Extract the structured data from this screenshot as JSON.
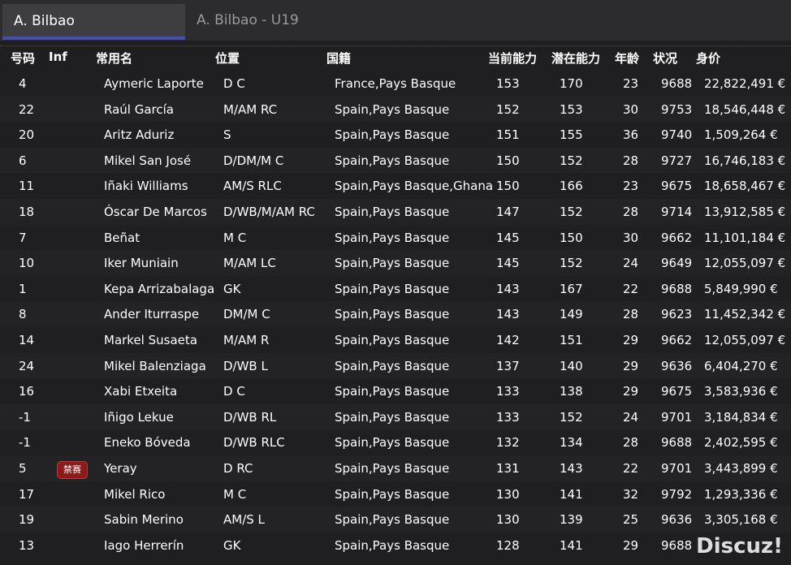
{
  "tabs": [
    {
      "label": "A. Bilbao"
    },
    {
      "label": "A. Bilbao - U19"
    }
  ],
  "headers": {
    "num": "号码",
    "inf": "Inf",
    "name": "常用名",
    "pos": "位置",
    "nat": "国籍",
    "ca": "当前能力",
    "pa": "潜在能力",
    "age": "年龄",
    "cond": "状况",
    "val": "身价"
  },
  "rows": [
    {
      "num": "4",
      "inf": "",
      "name": "Aymeric Laporte",
      "pos": "D C",
      "nat": "France,Pays Basque",
      "ca": "153",
      "pa": "170",
      "age": "23",
      "cond": "9688",
      "val": "22,822,491 €"
    },
    {
      "num": "22",
      "inf": "",
      "name": "Raúl García",
      "pos": "M/AM RC",
      "nat": "Spain,Pays Basque",
      "ca": "152",
      "pa": "153",
      "age": "30",
      "cond": "9753",
      "val": "18,546,448 €"
    },
    {
      "num": "20",
      "inf": "",
      "name": "Aritz Aduriz",
      "pos": "S",
      "nat": "Spain,Pays Basque",
      "ca": "151",
      "pa": "155",
      "age": "36",
      "cond": "9740",
      "val": "1,509,264 €"
    },
    {
      "num": "6",
      "inf": "",
      "name": "Mikel San José",
      "pos": "D/DM/M C",
      "nat": "Spain,Pays Basque",
      "ca": "150",
      "pa": "152",
      "age": "28",
      "cond": "9727",
      "val": "16,746,183 €"
    },
    {
      "num": "11",
      "inf": "",
      "name": "Iñaki Williams",
      "pos": "AM/S RLC",
      "nat": "Spain,Pays Basque,Ghana",
      "ca": "150",
      "pa": "166",
      "age": "23",
      "cond": "9675",
      "val": "18,658,467 €"
    },
    {
      "num": "18",
      "inf": "",
      "name": "Óscar De Marcos",
      "pos": "D/WB/M/AM RC",
      "nat": "Spain,Pays Basque",
      "ca": "147",
      "pa": "152",
      "age": "28",
      "cond": "9714",
      "val": "13,912,585 €"
    },
    {
      "num": "7",
      "inf": "",
      "name": "Beñat",
      "pos": "M C",
      "nat": "Spain,Pays Basque",
      "ca": "145",
      "pa": "150",
      "age": "30",
      "cond": "9662",
      "val": "11,101,184 €"
    },
    {
      "num": "10",
      "inf": "",
      "name": "Iker Muniain",
      "pos": "M/AM LC",
      "nat": "Spain,Pays Basque",
      "ca": "145",
      "pa": "152",
      "age": "24",
      "cond": "9649",
      "val": "12,055,097 €"
    },
    {
      "num": "1",
      "inf": "",
      "name": "Kepa Arrizabalaga",
      "pos": "GK",
      "nat": "Spain,Pays Basque",
      "ca": "143",
      "pa": "167",
      "age": "22",
      "cond": "9688",
      "val": "5,849,990 €"
    },
    {
      "num": "8",
      "inf": "",
      "name": "Ander Iturraspe",
      "pos": "DM/M C",
      "nat": "Spain,Pays Basque",
      "ca": "143",
      "pa": "149",
      "age": "28",
      "cond": "9623",
      "val": "11,452,342 €"
    },
    {
      "num": "14",
      "inf": "",
      "name": "Markel Susaeta",
      "pos": "M/AM R",
      "nat": "Spain,Pays Basque",
      "ca": "142",
      "pa": "151",
      "age": "29",
      "cond": "9662",
      "val": "12,055,097 €"
    },
    {
      "num": "24",
      "inf": "",
      "name": "Mikel Balenziaga",
      "pos": "D/WB L",
      "nat": "Spain,Pays Basque",
      "ca": "137",
      "pa": "140",
      "age": "29",
      "cond": "9636",
      "val": "6,404,270 €"
    },
    {
      "num": "16",
      "inf": "",
      "name": "Xabi Etxeita",
      "pos": "D C",
      "nat": "Spain,Pays Basque",
      "ca": "133",
      "pa": "138",
      "age": "29",
      "cond": "9675",
      "val": "3,583,936 €"
    },
    {
      "num": "-1",
      "inf": "",
      "name": "Iñigo Lekue",
      "pos": "D/WB RL",
      "nat": "Spain,Pays Basque",
      "ca": "133",
      "pa": "152",
      "age": "24",
      "cond": "9701",
      "val": "3,184,834 €"
    },
    {
      "num": "-1",
      "inf": "",
      "name": "Eneko Bóveda",
      "pos": "D/WB RLC",
      "nat": "Spain,Pays Basque",
      "ca": "132",
      "pa": "134",
      "age": "28",
      "cond": "9688",
      "val": "2,402,595 €"
    },
    {
      "num": "5",
      "inf": "禁赛",
      "name": "Yeray",
      "pos": "D RC",
      "nat": "Spain,Pays Basque",
      "ca": "131",
      "pa": "143",
      "age": "22",
      "cond": "9701",
      "val": "3,443,899 €"
    },
    {
      "num": "17",
      "inf": "",
      "name": "Mikel Rico",
      "pos": "M C",
      "nat": "Spain,Pays Basque",
      "ca": "130",
      "pa": "141",
      "age": "32",
      "cond": "9792",
      "val": "1,293,336 €"
    },
    {
      "num": "19",
      "inf": "",
      "name": "Sabin Merino",
      "pos": "AM/S L",
      "nat": "Spain,Pays Basque",
      "ca": "130",
      "pa": "139",
      "age": "25",
      "cond": "9636",
      "val": "3,305,168 €"
    },
    {
      "num": "13",
      "inf": "",
      "name": "Iago Herrerín",
      "pos": "GK",
      "nat": "Spain,Pays Basque",
      "ca": "128",
      "pa": "141",
      "age": "29",
      "cond": "9688",
      "val": ""
    }
  ],
  "watermark": "Discuz!"
}
